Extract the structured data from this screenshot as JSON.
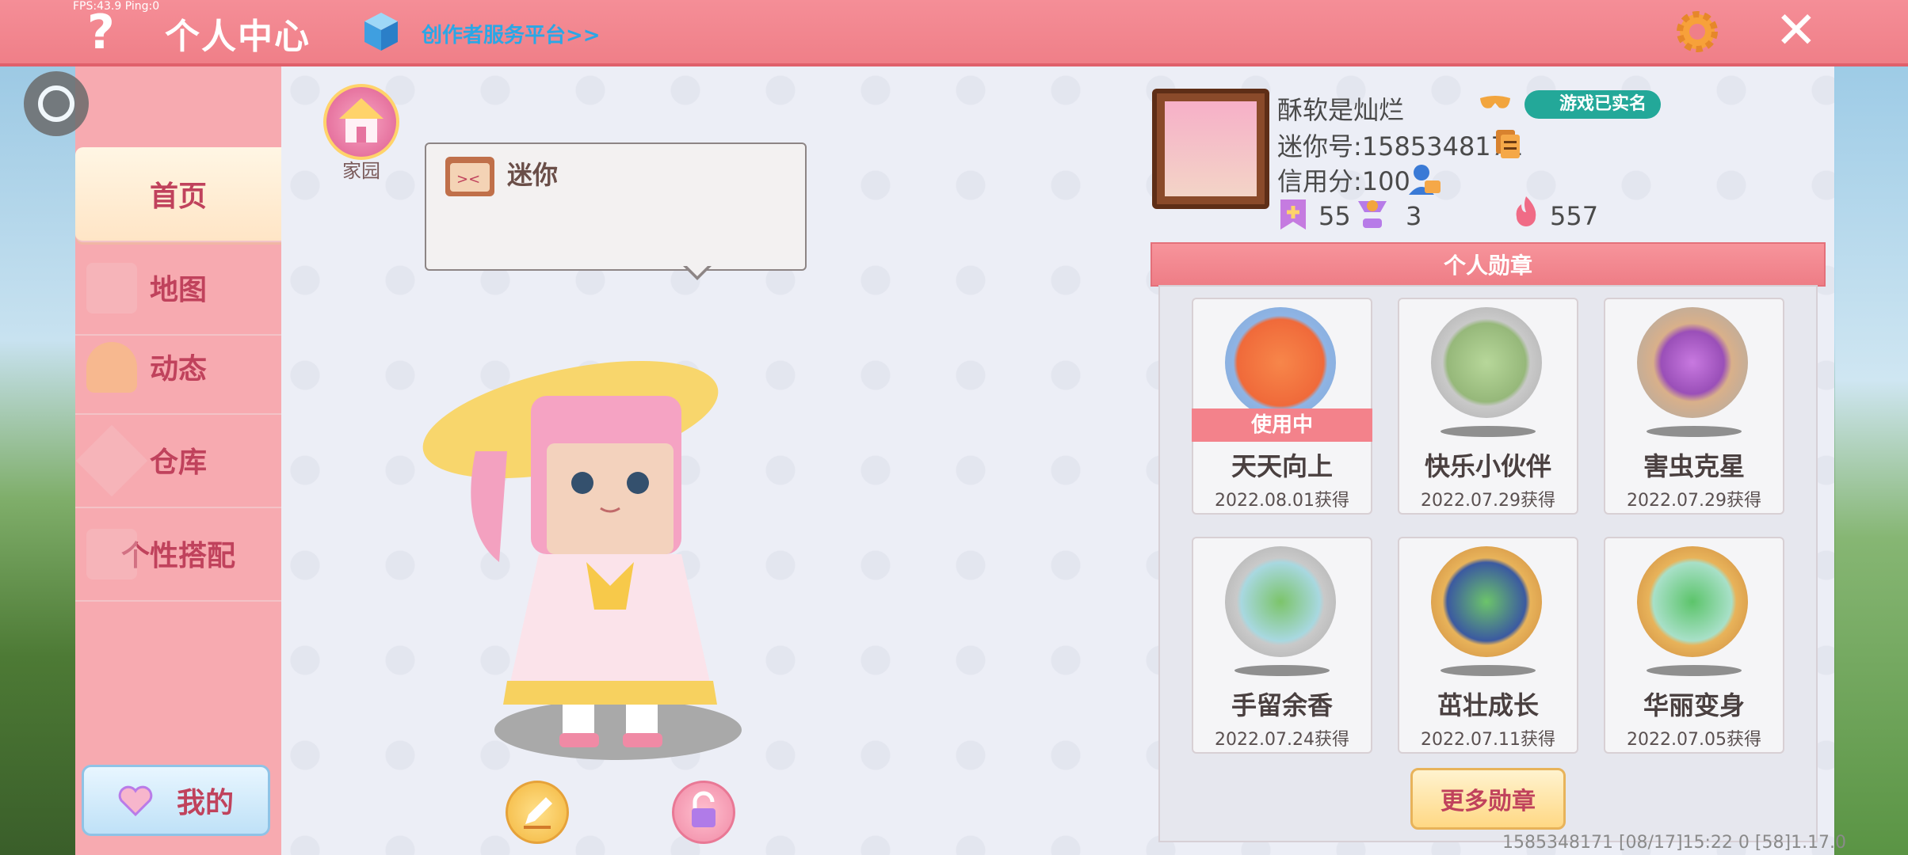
{
  "overlay": {
    "fps": "FPS:43.9  Ping:0"
  },
  "header": {
    "help_icon": "?",
    "title": "个人中心",
    "creator_link": "创作者服务平台>>",
    "close_icon": "✕"
  },
  "sidebar": {
    "items": [
      {
        "label": "首页"
      },
      {
        "label": "地图"
      },
      {
        "label": "动态"
      },
      {
        "label": "仓库"
      },
      {
        "label": "个性搭配"
      }
    ],
    "mine_label": "我的"
  },
  "home": {
    "label": "家园"
  },
  "bubble": {
    "text": "迷你"
  },
  "profile": {
    "name": "酥软是灿烂",
    "id_text": "迷你号:1585348171",
    "credit_text": "信用分:100",
    "real_name_badge": "游戏已实名",
    "stats": [
      {
        "icon": "bookmark-plus-icon",
        "value": "55"
      },
      {
        "icon": "trophy-person-icon",
        "value": "3"
      },
      {
        "icon": "flame-icon",
        "value": "557"
      }
    ]
  },
  "medals": {
    "title": "个人勋章",
    "in_use_label": "使用中",
    "items": [
      {
        "name": "天天向上",
        "date": "2022.08.01获得",
        "ring": "#7fa7d8"
      },
      {
        "name": "快乐小伙伴",
        "date": "2022.07.29获得",
        "ring": "#a9a9a9"
      },
      {
        "name": "害虫克星",
        "date": "2022.07.29获得",
        "ring": "#a9a9a9"
      },
      {
        "name": "手留余香",
        "date": "2022.07.24获得",
        "ring": "#a9a9a9"
      },
      {
        "name": "茁壮成长",
        "date": "2022.07.11获得",
        "ring": "#d89a4a"
      },
      {
        "name": "华丽变身",
        "date": "2022.07.05获得",
        "ring": "#d89a4a"
      }
    ],
    "more_label": "更多勋章"
  },
  "footer": {
    "text": "1585348171   [08/17]15:22 0   [58]1.17.0"
  }
}
